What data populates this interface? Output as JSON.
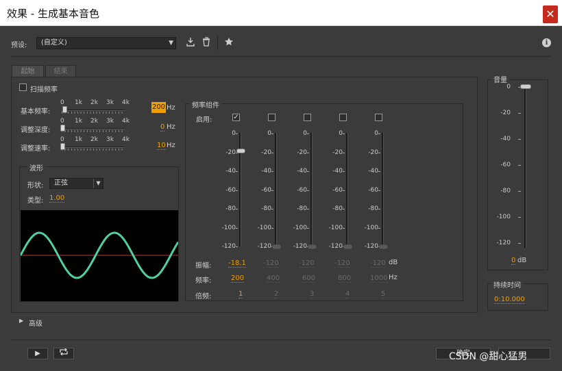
{
  "window": {
    "title": "效果 - 生成基本音色",
    "close_glyph": "✕"
  },
  "toolbar": {
    "preset_label": "预设:",
    "preset_value": "(自定义)",
    "info_glyph": "ℹ"
  },
  "tabs": [
    {
      "label": "起始"
    },
    {
      "label": "结束"
    }
  ],
  "sweep": {
    "label": "扫描频率"
  },
  "params": {
    "base_freq": {
      "label": "基本频率:",
      "value": "200",
      "unit": "Hz"
    },
    "mod_depth": {
      "label": "调整深度:",
      "value": "0",
      "unit": "Hz"
    },
    "mod_rate": {
      "label": "调整速率:",
      "value": "10",
      "unit": "Hz"
    },
    "scale_ticks": [
      "0",
      "1k",
      "2k",
      "3k",
      "4k"
    ]
  },
  "waveform": {
    "group_label": "波形",
    "shape_label": "形状:",
    "shape_value": "正弦",
    "type_label": "类型:",
    "type_value": "1.00"
  },
  "freq_components": {
    "group_label": "频率组件",
    "enable_label": "启用:",
    "enabled": [
      true,
      false,
      false,
      false,
      false
    ],
    "meter_scale": [
      "0",
      "-20",
      "-40",
      "-60",
      "-80",
      "-100",
      "-120"
    ],
    "amplitude_label": "振幅:",
    "frequency_label": "频率:",
    "multiple_label": "倍频:",
    "amplitudes": [
      "-18.1",
      "-120",
      "-120",
      "-120",
      "-120"
    ],
    "frequencies": [
      "200",
      "400",
      "600",
      "800",
      "1000"
    ],
    "multiples": [
      "1",
      "2",
      "3",
      "4",
      "5"
    ],
    "db_unit": "dB",
    "hz_unit": "Hz"
  },
  "volume": {
    "label": "音量",
    "scale": [
      "0",
      "-20",
      "-40",
      "-60",
      "-80",
      "-100",
      "-120"
    ],
    "value": "0",
    "unit": "dB"
  },
  "duration": {
    "label": "持续时间",
    "value": "0:10.000"
  },
  "advanced": {
    "label": "高级"
  },
  "footer": {
    "ok_label": "确定",
    "watermark": "CSDN @甜心猛男"
  },
  "colors": {
    "accent": "#f0a000",
    "wave": "#4fd1a5",
    "baseline": "#c0392b",
    "close": "#c42b1c"
  }
}
